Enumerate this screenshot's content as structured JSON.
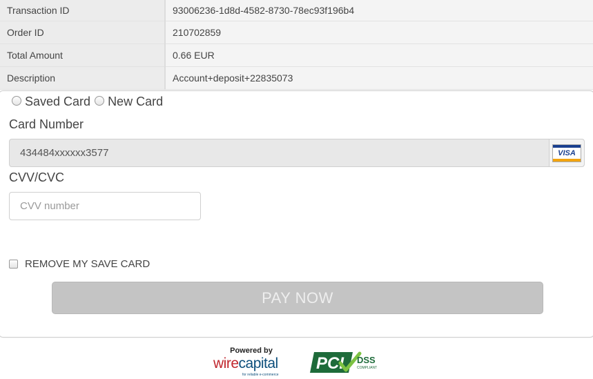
{
  "transaction": {
    "rows": [
      {
        "label": "Transaction ID",
        "value": "93006236-1d8d-4582-8730-78ec93f196b4"
      },
      {
        "label": "Order ID",
        "value": "210702859"
      },
      {
        "label": "Total Amount",
        "value": "0.66 EUR"
      },
      {
        "label": "Description",
        "value": "Account+deposit+22835073"
      }
    ]
  },
  "payment_form": {
    "saved_card_label": "Saved Card",
    "new_card_label": "New Card",
    "card_number_label": "Card Number",
    "card_number_value": "434484xxxxxx3577",
    "card_brand": "VISA",
    "card_brand_icon": "visa-card-icon",
    "cvv_label": "CVV/CVC",
    "cvv_placeholder": "CVV number",
    "cvv_value": "",
    "remove_saved_card_label": "REMOVE MY SAVE CARD",
    "remove_saved_card_checked": false,
    "pay_button_label": "PAY NOW",
    "pay_button_enabled": false
  },
  "footer": {
    "powered_by_text": "Powered by",
    "wire_capital_logo": {
      "brand_text_part1": "wire",
      "brand_text_part2": "capital",
      "tagline": "for reliable e-commerce"
    },
    "pci_logo": {
      "brand_text": "PCI",
      "dss_text": "DSS",
      "compliant_text": "COMPLIANT"
    }
  },
  "colors": {
    "table_label_bg": "#ececec",
    "table_value_bg": "#f4f4f4",
    "pay_button_disabled": "#c4c4c4",
    "wire_red": "#c0262d",
    "wire_blue": "#0d4f7c",
    "pci_green": "#1e6b3a",
    "visa_blue": "#1a3f8f",
    "visa_gold": "#f2a30f"
  }
}
